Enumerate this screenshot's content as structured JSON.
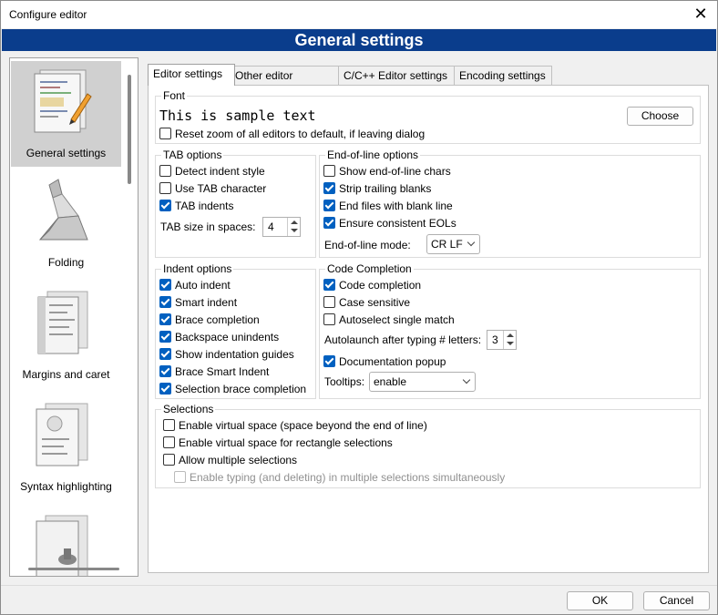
{
  "window": {
    "title": "Configure editor",
    "close_label": "✕"
  },
  "banner": "General settings",
  "sidebar": {
    "items": [
      {
        "label": "General settings",
        "icon": "general-settings-icon"
      },
      {
        "label": "Folding",
        "icon": "folding-icon"
      },
      {
        "label": "Margins and caret",
        "icon": "margins-caret-icon"
      },
      {
        "label": "Syntax highlighting",
        "icon": "syntax-highlighting-icon"
      },
      {
        "label": "",
        "icon": "default-code-icon"
      }
    ]
  },
  "tabs": [
    "Editor settings",
    "Other editor settings",
    "C/C++ Editor settings",
    "Encoding settings"
  ],
  "font": {
    "title": "Font",
    "sample": "This is sample text",
    "choose_label": "Choose",
    "reset_zoom": {
      "label": "Reset zoom of all editors to default, if leaving dialog",
      "checked": false
    }
  },
  "tab_options": {
    "title": "TAB options",
    "items": [
      {
        "label": "Detect indent style",
        "checked": false
      },
      {
        "label": "Use TAB character",
        "checked": false
      },
      {
        "label": "TAB indents",
        "checked": true
      }
    ],
    "size_label": "TAB size in spaces:",
    "size_value": "4"
  },
  "eol_options": {
    "title": "End-of-line options",
    "items": [
      {
        "label": "Show end-of-line chars",
        "checked": false
      },
      {
        "label": "Strip trailing blanks",
        "checked": true
      },
      {
        "label": "End files with blank line",
        "checked": true
      },
      {
        "label": "Ensure consistent EOLs",
        "checked": true
      }
    ],
    "mode_label": "End-of-line mode:",
    "mode_value": "CR LF"
  },
  "indent_options": {
    "title": "Indent options",
    "items": [
      {
        "label": "Auto indent",
        "checked": true
      },
      {
        "label": "Smart indent",
        "checked": true
      },
      {
        "label": "Brace completion",
        "checked": true
      },
      {
        "label": "Backspace unindents",
        "checked": true
      },
      {
        "label": "Show indentation guides",
        "checked": true
      },
      {
        "label": "Brace Smart Indent",
        "checked": true
      },
      {
        "label": "Selection brace completion",
        "checked": true
      }
    ]
  },
  "code_completion": {
    "title": "Code Completion",
    "items": [
      {
        "label": "Code completion",
        "checked": true
      },
      {
        "label": "Case sensitive",
        "checked": false
      },
      {
        "label": "Autoselect single match",
        "checked": false
      }
    ],
    "autolaunch_label": "Autolaunch after typing # letters:",
    "autolaunch_value": "3",
    "doc_popup": {
      "label": "Documentation popup",
      "checked": true
    },
    "tooltips_label": "Tooltips:",
    "tooltips_value": "enable"
  },
  "selections": {
    "title": "Selections",
    "items": [
      {
        "label": "Enable virtual space (space beyond the end of line)",
        "checked": false
      },
      {
        "label": "Enable virtual space for rectangle selections",
        "checked": false
      },
      {
        "label": "Allow multiple selections",
        "checked": false
      },
      {
        "label": "Enable typing (and deleting) in multiple selections simultaneously",
        "checked": false,
        "disabled": true
      }
    ]
  },
  "footer": {
    "ok_label": "OK",
    "cancel_label": "Cancel"
  },
  "colors": {
    "banner_bg": "#0a3d8c",
    "checkbox_on": "#0060c0"
  }
}
